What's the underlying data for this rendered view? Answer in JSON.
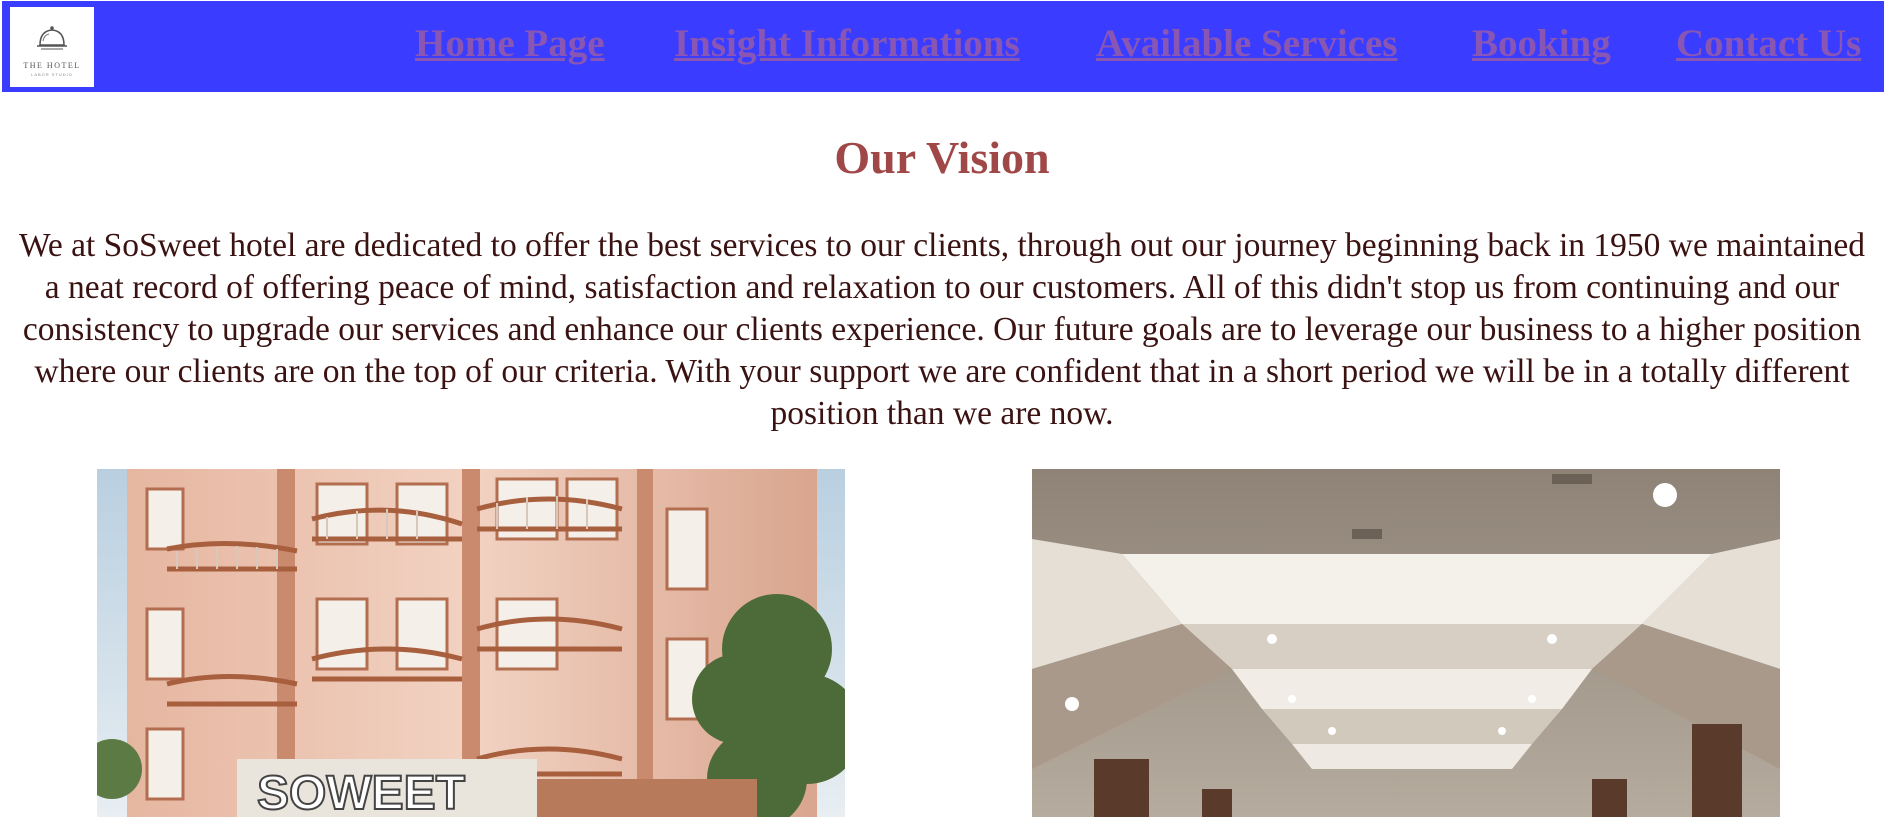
{
  "brand": {
    "logo_name": "THE HOTEL",
    "logo_tagline": "LABOR STUDIO",
    "nav_bg": "#3a3cff",
    "link_color": "#8a56b4"
  },
  "nav": {
    "items": [
      {
        "label": "Home Page"
      },
      {
        "label": "Insight Informations"
      },
      {
        "label": "Available Services"
      },
      {
        "label": "Booking"
      },
      {
        "label": "Contact Us"
      }
    ]
  },
  "main": {
    "title": "Our Vision",
    "title_color": "#a04848",
    "paragraph": "We at SoSweet hotel are dedicated to offer the best services to our clients, through out our journey beginning back in 1950 we maintained a neat record of offering peace of mind, satisfaction and relaxation to our customers. All of this didn't stop us from continuing and our consistency to upgrade our services and enhance our clients experience. Our future goals are to leverage our business to a higher position where our clients are on the top of our criteria. With your support we are confident that in a short period we will be in a totally different position than we are now.",
    "images": [
      {
        "name": "hotel-facade",
        "sign_text": "SOWEET"
      },
      {
        "name": "hotel-lobby-ceiling"
      }
    ]
  }
}
